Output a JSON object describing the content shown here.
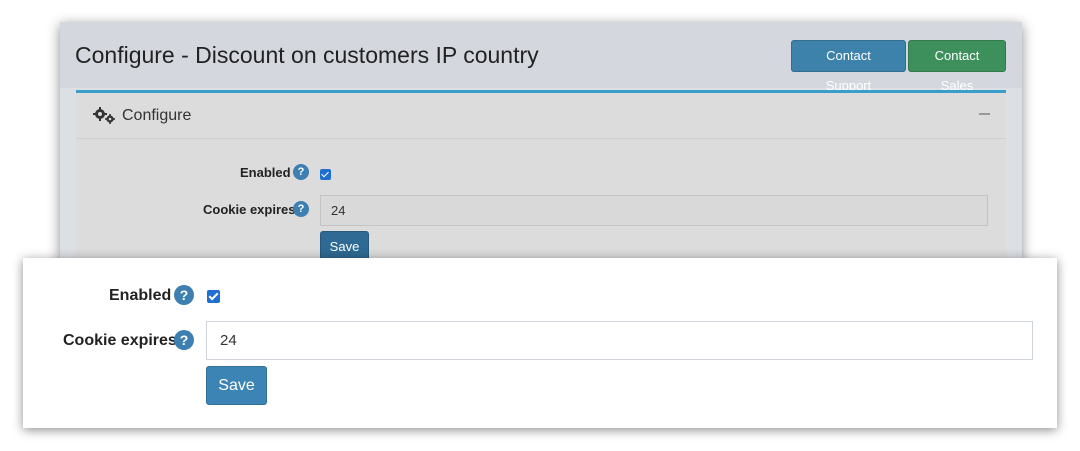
{
  "page": {
    "title": "Configure - Discount on customers IP country",
    "buttons": {
      "support": "Contact Support",
      "sales": "Contact Sales"
    }
  },
  "box": {
    "title": "Configure"
  },
  "form": {
    "enabled_label": "Enabled",
    "enabled_checked": true,
    "cookie_label": "Cookie expires",
    "cookie_value": "24",
    "help_glyph": "?",
    "save_label": "Save"
  },
  "icons": {
    "box": "cogs-icon",
    "collapse": "minus-icon",
    "help": "question-circle-icon"
  },
  "colors": {
    "primary": "#3c84b4",
    "success": "#3d8f5c",
    "accent_border": "#3a9ec9",
    "checkbox": "#1f6fd1"
  }
}
